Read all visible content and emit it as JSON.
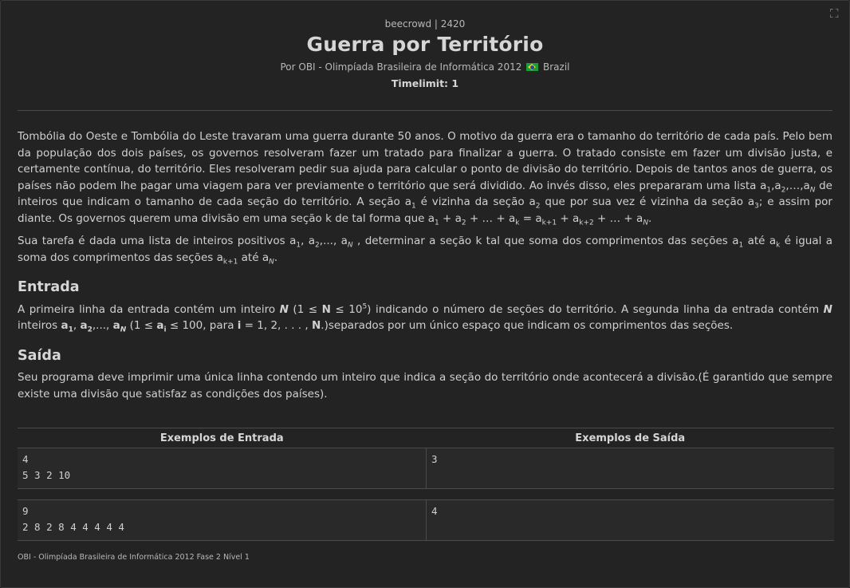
{
  "header": {
    "source": "beecrowd | 2420",
    "title": "Guerra por Território",
    "author_prefix": "Por OBI - Olimpíada Brasileira de Informática 2012",
    "country": "Brazil",
    "timelimit": "Timelimit: 1"
  },
  "description": {
    "p1_a": "Tombólia do Oeste e Tombólia do Leste travaram uma guerra durante 50 anos. O motivo da guerra era o tamanho do território de cada país. Pelo bem da população dos dois países, os governos resolveram fazer um tratado para finalizar a guerra. O tratado consiste em fazer um divisão justa, e certamente contínua, do território. Eles resolveram pedir sua ajuda para calcular o ponto de divisão do território. Depois de tantos anos de guerra, os países não podem lhe pagar uma viagem para ver previamente o território que será dividido. Ao invés disso, eles prepararam uma lista ",
    "p1_b": " de inteiros que indicam o tamanho de cada seção do território. A seção ",
    "p1_c": " é vizinha da seção ",
    "p1_d": " que por sua vez é vizinha da seção ",
    "p1_e": "; e assim por diante. Os governos querem uma divisão em uma seção k de tal forma que ",
    "p2_a": "Sua tarefa é dada uma lista de inteiros positivos ",
    "p2_b": ", determinar a seção k tal que soma dos comprimentos das seções ",
    "p2_c": " até ",
    "p2_d": " é igual a soma dos comprimentos das seções ",
    "p2_e": " até "
  },
  "input_section": {
    "heading": "Entrada",
    "t1": "A primeira linha da entrada contém um inteiro ",
    "t2": " indicando o número de seções do território. A segunda linha da entrada contém ",
    "t3": " inteiros ",
    "t4": "separados por um único espaço que indicam os comprimentos das seções."
  },
  "output_section": {
    "heading": "Saída",
    "text": "Seu programa deve imprimir uma única linha contendo um inteiro que indica a seção do território onde acontecerá a divisão.(É garantido que sempre existe uma divisão que satisfaz as condições dos países)."
  },
  "examples": {
    "input_header": "Exemplos de Entrada",
    "output_header": "Exemplos de Saída",
    "cases": [
      {
        "input": "4\n5 3 2 10",
        "output": "3"
      },
      {
        "input": "9\n2 8 2 8 4 4 4 4 4",
        "output": "4"
      }
    ]
  },
  "footer": "OBI - Olimpíada Brasileira de Informática 2012 Fase 2 Nível 1",
  "icons": {
    "expand": "expand-icon",
    "flag": "brazil-flag-icon"
  }
}
